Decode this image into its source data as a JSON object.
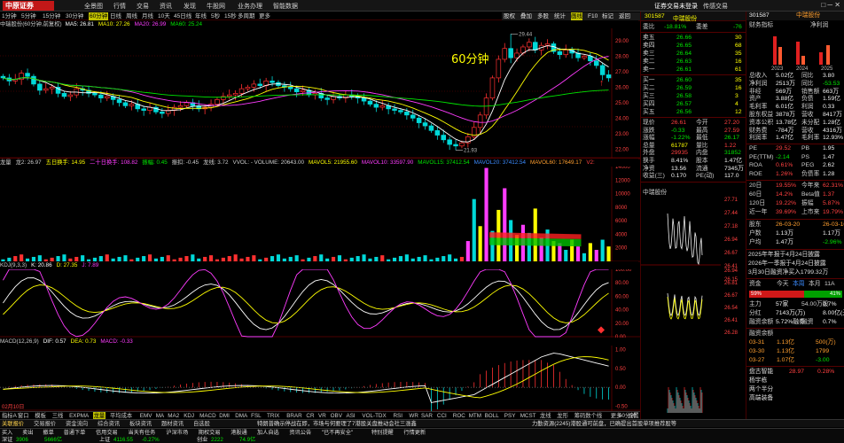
{
  "app": {
    "logo": "中原证券",
    "menus": [
      "全景图",
      "行情",
      "交易",
      "资讯",
      "发现",
      "牛股网",
      "业务办理",
      "智能数据"
    ],
    "window_controls": "□ ─ ✕",
    "login": "证券交易未登录",
    "feedback": "传感交易"
  },
  "period_bar": {
    "items": [
      "1分钟",
      "5分钟",
      "15分钟",
      "30分钟",
      "60分钟",
      "日线",
      "周线",
      "月线",
      "10天",
      "45日线",
      "年线",
      "5秒",
      "15秒",
      "多周期",
      "更多"
    ],
    "active": "60分钟"
  },
  "chart_tools": {
    "items": [
      "股权",
      "叠加",
      "多股",
      "统计",
      "画线",
      "F10",
      "标记",
      "返回"
    ],
    "active": "画线"
  },
  "main_chart": {
    "header": "中瑞股份(60分钟,前复权)",
    "ma_legend": [
      {
        "label": "MA5: 26.81",
        "color": "#ffffff"
      },
      {
        "label": "MA10: 27.26",
        "color": "#ffff00"
      },
      {
        "label": "MA20: 26.99",
        "color": "#ff3cff"
      },
      {
        "label": "MA60: 25.24",
        "color": "#00e600"
      }
    ],
    "title_overlay": "60分钟",
    "high_label": "29.44",
    "low_label": "21.93",
    "y_ticks": [
      "29.00",
      "28.00",
      "27.00",
      "26.00",
      "25.00",
      "24.00",
      "23.00",
      "22.00"
    ]
  },
  "volume_chart": {
    "legend": [
      {
        "label": "龙量",
        "color": "#cccccc"
      },
      {
        "label": "龙2: 26.97",
        "color": "#cccccc"
      },
      {
        "label": "五日换手: 14.95",
        "color": "#ffff00"
      },
      {
        "label": "二十日换手: 108.82",
        "color": "#ff3cff"
      },
      {
        "label": "振幅: 0.45",
        "color": "#00e600"
      },
      {
        "label": "振扣: -0.45",
        "color": "#cccccc"
      },
      {
        "label": "龙线: 3.72",
        "color": "#cccccc"
      },
      {
        "label": "VVOL: - VOLUME: 20643.00",
        "color": "#cccccc"
      },
      {
        "label": "MAVOL5: 21955.60",
        "color": "#ffff00"
      },
      {
        "label": "MAVOL10: 33597.90",
        "color": "#ff3cff"
      },
      {
        "label": "MAVOL15: 37412.54",
        "color": "#00e600"
      },
      {
        "label": "MAVOL20: 37412.54",
        "color": "#3c8cff"
      },
      {
        "label": "MAVOL60: 17649.17",
        "color": "#ff9f2f"
      },
      {
        "label": "V2:",
        "color": "#ff4040"
      }
    ],
    "y_ticks": [
      "14000",
      "12000",
      "10000",
      "8000",
      "6000",
      "4000",
      "2000"
    ]
  },
  "kdj_chart": {
    "legend": [
      {
        "label": "KDJ(9,3,3)",
        "color": "#cccccc"
      },
      {
        "label": "K: 20.86",
        "color": "#ffffff"
      },
      {
        "label": "D: 27.35",
        "color": "#ffff00"
      },
      {
        "label": "J: 7.89",
        "color": "#ff3cff"
      }
    ],
    "y_ticks": [
      "100.00",
      "80.00",
      "60.00",
      "40.00",
      "20.00",
      "0.00"
    ]
  },
  "macd_chart": {
    "legend": [
      {
        "label": "MACD(12,26,9)",
        "color": "#cccccc"
      },
      {
        "label": "DIF: 0.57",
        "color": "#ffffff"
      },
      {
        "label": "DEA: 0.73",
        "color": "#ffff00"
      },
      {
        "label": "MACD: -0.33",
        "color": "#ff3cff"
      }
    ],
    "y_ticks": [
      "1.00",
      "0.50",
      "0.00",
      "-0.50"
    ],
    "date_label": "02月10日"
  },
  "bottom_tabs": {
    "items": [
      "指标A",
      "窗口",
      "模板",
      "三线",
      "EXPMA",
      "龙量",
      "平均成本",
      "EMV",
      "MA",
      "MA2",
      "KDJ",
      "MACD",
      "DMI",
      "DMA",
      "FSL",
      "TRIX",
      "BRAR",
      "CR",
      "VR",
      "OBV",
      "ASI",
      "VOL-TDX",
      "RSI",
      "WR",
      "SAR",
      "CCI",
      "ROC",
      "MTM",
      "BOLL",
      "PSY",
      "MCST",
      "龙线",
      "龙形",
      "筹码数个线",
      "更多",
      "设置"
    ],
    "active": "龙量",
    "right": "60分钟"
  },
  "info_tabs": {
    "items": [
      "关联报价",
      "交易报价",
      "资金流向",
      "综合资讯",
      "板块资讯",
      "题材资讯",
      "自选股"
    ],
    "active": "关联报价"
  },
  "status": {
    "items": [
      "买入",
      "卖出",
      "撤单",
      "普通下单",
      "信用交易",
      "当天有任务",
      "沪深市场",
      "期权交易",
      "港股通",
      "加人自选",
      "资讯公告",
      "\"已不再安全\"",
      "特别提醒",
      "行情更新"
    ],
    "indices": [
      {
        "name": "深证",
        "value": "3906",
        "pct": "5666亿",
        "color": "#00e600"
      },
      {
        "name": "上证",
        "value": "4116.55",
        "pct": "-0.27%",
        "color": "#00e600"
      },
      {
        "name": "创业",
        "value": "2222",
        "pct": "74.9亿",
        "color": "#00e600"
      }
    ],
    "ticker_text": "特朗普确示停战在即，市场与何要理了7港股关盘推动会社三涨鑫",
    "ticker_text2": "力勤资源(2245)港股通可前盘，已确提出首股单项推荐股等"
  },
  "quote": {
    "code": "301587",
    "name": "中瑞股份",
    "wei_bi": {
      "label": "委比",
      "value": "-18.81%",
      "extra_label": "委差",
      "extra": "-76"
    },
    "sell": [
      {
        "label": "卖五",
        "price": "26.66",
        "vol": "30"
      },
      {
        "label": "卖四",
        "price": "26.65",
        "vol": "68"
      },
      {
        "label": "卖三",
        "price": "26.64",
        "vol": "35"
      },
      {
        "label": "卖二",
        "price": "26.63",
        "vol": "16"
      },
      {
        "label": "卖一",
        "price": "26.61",
        "vol": "61"
      }
    ],
    "buy": [
      {
        "label": "买一",
        "price": "26.60",
        "vol": "35"
      },
      {
        "label": "买二",
        "price": "26.59",
        "vol": "16"
      },
      {
        "label": "买三",
        "price": "26.58",
        "vol": "3"
      },
      {
        "label": "买四",
        "price": "26.57",
        "vol": "4"
      },
      {
        "label": "买五",
        "price": "26.56",
        "vol": "12"
      }
    ],
    "stats": [
      {
        "l1": "现价",
        "v1": "26.61",
        "l2": "今开",
        "v2": "27.20",
        "c1": "#ff4040",
        "c2": "#ff4040"
      },
      {
        "l1": "涨跌",
        "v1": "-0.33",
        "l2": "最高",
        "v2": "27.59",
        "c1": "#00e600",
        "c2": "#ff4040"
      },
      {
        "l1": "涨幅",
        "v1": "-1.22%",
        "l2": "最低",
        "v2": "26.17",
        "c1": "#00e600",
        "c2": "#00e600"
      },
      {
        "l1": "总量",
        "v1": "61787",
        "l2": "量比",
        "v2": "1.22",
        "c1": "#ffff00",
        "c2": "#ff4040"
      },
      {
        "l1": "外盘",
        "v1": "29935",
        "l2": "内盘",
        "v2": "31852",
        "c1": "#ff4040",
        "c2": "#00e600"
      },
      {
        "l1": "换手",
        "v1": "8.41%",
        "l2": "股本",
        "v2": "1.47亿",
        "c1": "#eeeeee",
        "c2": "#eeeeee"
      },
      {
        "l1": "净资",
        "v1": "13.56",
        "l2": "流通",
        "v2": "7345万",
        "c1": "#eeeeee",
        "c2": "#eeeeee"
      },
      {
        "l1": "收益(三)",
        "v1": "0.170",
        "l2": "PE(动)",
        "v2": "117.0",
        "c1": "#eeeeee",
        "c2": "#eeeeee"
      }
    ],
    "intraday_title": "中瑞股份",
    "intraday_ticks": [
      "27.71",
      "27.44",
      "27.18",
      "26.94",
      "26.67",
      "26.41",
      "26.15"
    ],
    "intraday_ticks_b": [
      "26.94",
      "26.81",
      "26.67",
      "26.54",
      "26.41",
      "26.28"
    ]
  },
  "side": {
    "code": "301587",
    "tabs": [
      "中瑞股份",
      "...",
      "△"
    ],
    "metrics_title": "财务指标",
    "labels_top": [
      "净利润",
      "总收入"
    ],
    "years": [
      "2023",
      "2024",
      "2025"
    ],
    "rows": [
      {
        "l": "总收入",
        "v": "5.02亿",
        "p": "同比",
        "pv": "3.80"
      },
      {
        "l": "净利润",
        "v": "2513万",
        "p": "同比",
        "pv": "-53.53"
      },
      {
        "l": "非经",
        "v": "569万",
        "p": "销售额",
        "pv": "663万"
      },
      {
        "l": "资产",
        "v": "3.88亿",
        "p": "负债",
        "pv": "1.59亿"
      },
      {
        "l": "毛利率",
        "v": "6.01亿",
        "p": "利润",
        "pv": "0.33"
      },
      {
        "l": "股东权益",
        "v": "3878万",
        "p": "营收",
        "pv": "8417万"
      },
      {
        "l": "资本公积",
        "v": "13.78亿",
        "p": "未分配",
        "pv": "1.28亿"
      },
      {
        "l": "财务费",
        "v": "-784万",
        "p": "营收",
        "pv": "4316万"
      },
      {
        "l": "利润率",
        "v": "1.47亿",
        "p": "毛利率",
        "pv": "12.93%"
      }
    ],
    "valuation": [
      {
        "l": "PE",
        "v": "29.52",
        "p": "PB",
        "pv": "1.95"
      },
      {
        "l": "PE(TTM)",
        "v": "-2.14",
        "p": "PS",
        "pv": "1.47"
      },
      {
        "l": "ROA",
        "v": "0.61%",
        "p": "PEG",
        "pv": "2.62"
      },
      {
        "l": "ROE",
        "v": "1.26%",
        "p": "负债率",
        "pv": "1.28"
      }
    ],
    "perf": [
      {
        "l": "20日",
        "v": "19.55%",
        "p": "今年来",
        "pv": "62.31%"
      },
      {
        "l": "60日",
        "v": "14.2%",
        "p": "Beta值",
        "pv": "1.37"
      },
      {
        "l": "120日",
        "v": "19.22%",
        "p": "振幅",
        "pv": "5.87%"
      },
      {
        "l": "近一年",
        "v": "39.69%",
        "p": "上市来",
        "pv": "19.79%"
      }
    ],
    "holders": [
      {
        "l": "股东",
        "v": "26-03-20",
        "p": "",
        "pv": "26-03-10"
      },
      {
        "l": "户数",
        "v": "1.13万",
        "p": "",
        "pv": "1.17万"
      },
      {
        "l": "户均",
        "v": "1.47万",
        "p": "",
        "pv": "-2.96%"
      }
    ],
    "news": [
      "2025年年报于4月24日披露",
      "2026年一季报于4月24日披露",
      "3月30日融资净买入1799.32万"
    ],
    "flow_title": "资金",
    "flow_tabs": [
      "今天",
      "本周",
      "本月",
      "11A"
    ],
    "flow_sell": "59%",
    "flow_buy": "41%",
    "flow_rows": [
      {
        "l": "主力",
        "v": "57家",
        "p": "54.00万股",
        "pv": "0.7%"
      },
      {
        "l": "分红",
        "v": "7143万(万)",
        "p": "",
        "pv": "8.00亿(元)"
      },
      {
        "l": "融资余额",
        "v": "5.72%融券",
        "p": "融资",
        "pv": "0.7%"
      }
    ],
    "margin_title": "融资余额",
    "margin_rows": [
      {
        "d": "03-31",
        "v": "1.13亿",
        "p": "500(万)"
      },
      {
        "d": "03-30",
        "v": "1.13亿",
        "p": "1799"
      },
      {
        "d": "03-27",
        "v": "1.07亿",
        "p": "-3.00"
      }
    ],
    "bottom_ticker": [
      {
        "l": "盘古智能",
        "v": "28.97",
        "pv": "0.28%"
      },
      {
        "l": "杨宇栋",
        "v": "",
        "pv": ""
      },
      {
        "l": "两个半分",
        "v": "",
        "pv": ""
      },
      {
        "l": "高端装备",
        "v": "",
        "pv": ""
      }
    ]
  },
  "chart_data": [
    {
      "type": "candlestick",
      "title": "中瑞股份(60分钟,前复权)",
      "ylim": [
        21.5,
        29.8
      ],
      "annotations": [
        {
          "text": "29.44",
          "value": 29.44
        },
        {
          "text": "21.93",
          "value": 21.93
        }
      ],
      "close_series": [
        26.6,
        26.4,
        26.5,
        26.9,
        26.7,
        26.2,
        25.8,
        25.9,
        26.0,
        25.6,
        25.4,
        25.5,
        25.9,
        25.8,
        25.6,
        25.5,
        25.3,
        25.4,
        25.2,
        25.0,
        24.8,
        24.9,
        24.6,
        24.5,
        24.7,
        24.4,
        24.3,
        24.5,
        24.7,
        24.8,
        25.0,
        24.8,
        24.6,
        24.7,
        24.9,
        25.2,
        25.4,
        25.5,
        25.6,
        25.9,
        26.0,
        26.2,
        26.1,
        26.4,
        26.3,
        26.1,
        26.0,
        25.9,
        25.7,
        25.8,
        25.5,
        25.6,
        25.3,
        25.2,
        25.4,
        25.3,
        25.5,
        25.4,
        25.3,
        25.1,
        24.9,
        24.7,
        24.8,
        24.6,
        24.5,
        24.4,
        24.2,
        24.0,
        23.7,
        23.5,
        23.2,
        22.9,
        22.6,
        22.3,
        22.2,
        22.4,
        22.8,
        23.4,
        24.2,
        25.3,
        26.6,
        27.8,
        28.5,
        27.9,
        28.2,
        28.6,
        28.9,
        28.4,
        28.7,
        28.8,
        28.3,
        28.1,
        28.4,
        28.2,
        27.9,
        28.0,
        27.7,
        27.4,
        26.8,
        26.6
      ]
    },
    {
      "type": "bar",
      "title": "龙量",
      "ylim": [
        0,
        14000
      ]
    },
    {
      "type": "line",
      "title": "KDJ(9,3,3)",
      "ylim": [
        0,
        100
      ],
      "series": [
        {
          "name": "K",
          "last": 20.86
        },
        {
          "name": "D",
          "last": 27.35
        },
        {
          "name": "J",
          "last": 7.89
        }
      ]
    },
    {
      "type": "bar",
      "title": "MACD(12,26,9)",
      "ylim": [
        -0.6,
        1.1
      ],
      "series": [
        {
          "name": "DIF",
          "last": 0.57
        },
        {
          "name": "DEA",
          "last": 0.73
        },
        {
          "name": "MACD",
          "last": -0.33
        }
      ]
    }
  ]
}
